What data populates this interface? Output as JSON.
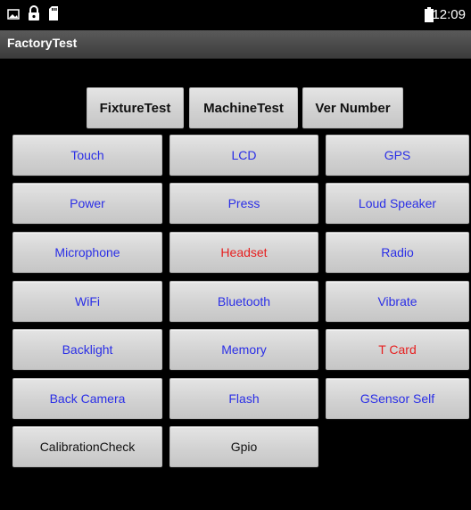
{
  "status_bar": {
    "time": "12:09",
    "icons": [
      "image-icon",
      "lock-icon",
      "sd-card-icon",
      "battery-icon"
    ]
  },
  "title_bar": {
    "title": "FactoryTest"
  },
  "top_buttons": {
    "fixture": "FixtureTest",
    "machine": "MachineTest",
    "version": "Ver Number"
  },
  "tests": {
    "touch": "Touch",
    "lcd": "LCD",
    "gps": "GPS",
    "power": "Power",
    "press": "Press",
    "loud_speaker": "Loud Speaker",
    "microphone": "Microphone",
    "headset": "Headset",
    "radio": "Radio",
    "wifi": "WiFi",
    "bluetooth": "Bluetooth",
    "vibrate": "Vibrate",
    "backlight": "Backlight",
    "memory": "Memory",
    "tcard": "T Card",
    "back_camera": "Back Camera",
    "flash": "Flash",
    "gsensor_self": "GSensor Self",
    "calibration_check": "CalibrationCheck",
    "gpio": "Gpio"
  },
  "colors": {
    "label_blue": "#2a2ee6",
    "label_red": "#e62020",
    "label_black": "#111111"
  }
}
